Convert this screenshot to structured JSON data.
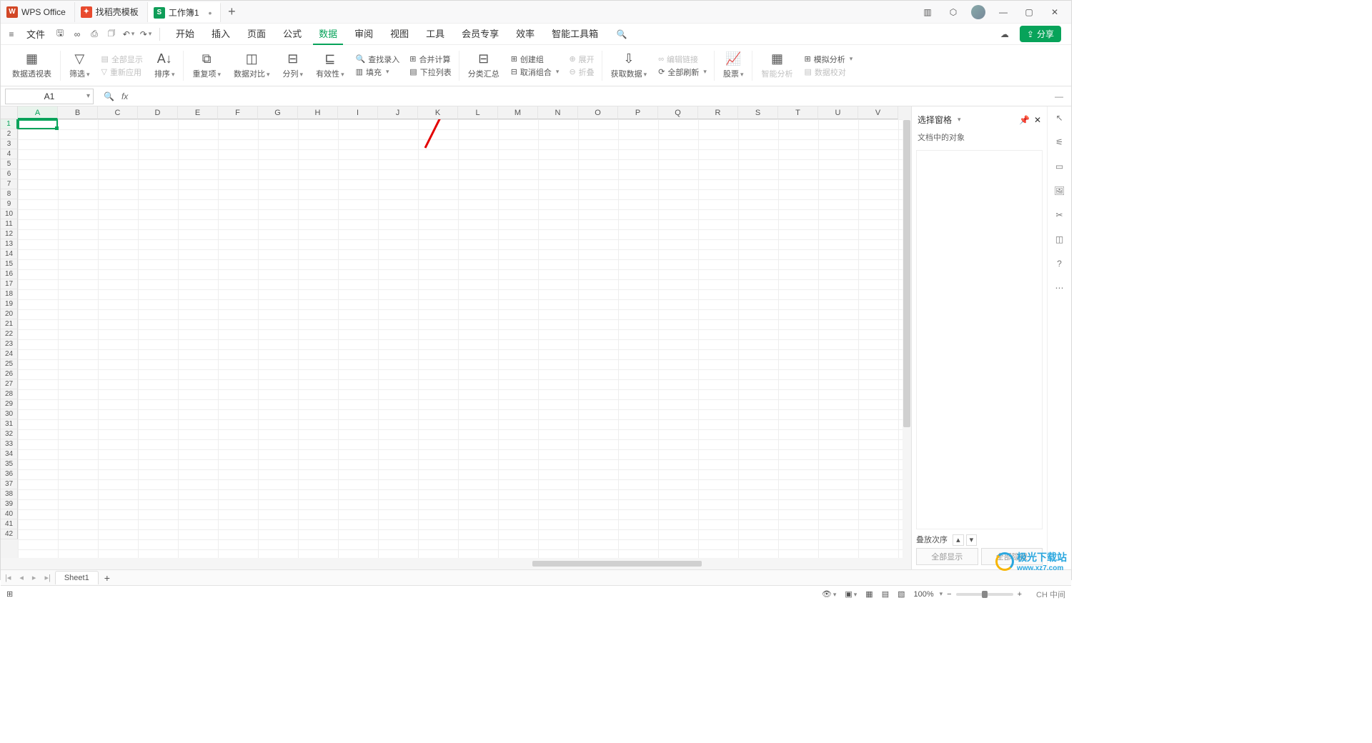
{
  "title_tabs": [
    {
      "icon_class": "red-icon",
      "icon_text": "W",
      "label": "WPS Office"
    },
    {
      "icon_class": "orange-icon",
      "icon_text": "✦",
      "label": "找稻壳模板"
    },
    {
      "icon_class": "green-icon",
      "icon_text": "S",
      "label": "工作簿1",
      "active": true,
      "closable": true
    }
  ],
  "win_icons": [
    "▭",
    "⬡",
    "◉",
    "—",
    "▢",
    "✕"
  ],
  "file_menu": "文件",
  "menu_tabs": [
    "开始",
    "插入",
    "页面",
    "公式",
    "数据",
    "审阅",
    "视图",
    "工具",
    "会员专享",
    "效率",
    "智能工具箱"
  ],
  "active_menu": "数据",
  "share_label": "分享",
  "ribbon": {
    "pivot": "数据透视表",
    "filter": "筛选",
    "show_all": "全部显示",
    "reapply": "重新应用",
    "sort": "排序",
    "dup": "重复项",
    "compare": "数据对比",
    "split": "分列",
    "valid": "有效性",
    "lookup": "查找录入",
    "consol": "合并计算",
    "fill": "填充",
    "dropdown": "下拉列表",
    "subtotal": "分类汇总",
    "group": "创建组",
    "ungroup": "取消组合",
    "expand": "展开",
    "collapse": "折叠",
    "getdata": "获取数据",
    "editlink": "编辑链接",
    "refresh": "全部刷新",
    "stock": "股票",
    "smart": "智能分析",
    "sim": "模拟分析",
    "validate": "数据校对"
  },
  "namebox": "A1",
  "panel": {
    "title": "选择窗格",
    "subtitle": "文档中的对象",
    "order": "叠放次序",
    "show_all": "全部显示",
    "hide_all": "全部隐藏"
  },
  "columns": [
    "A",
    "B",
    "C",
    "D",
    "E",
    "F",
    "G",
    "H",
    "I",
    "J",
    "K",
    "L",
    "M",
    "N",
    "O",
    "P",
    "Q",
    "R",
    "S",
    "T",
    "U",
    "V"
  ],
  "rows": 42,
  "sheet_name": "Sheet1",
  "zoom": "100%",
  "status_ime": "CH 中间",
  "watermark": {
    "name": "极光下载站",
    "url": "www.xz7.com"
  }
}
